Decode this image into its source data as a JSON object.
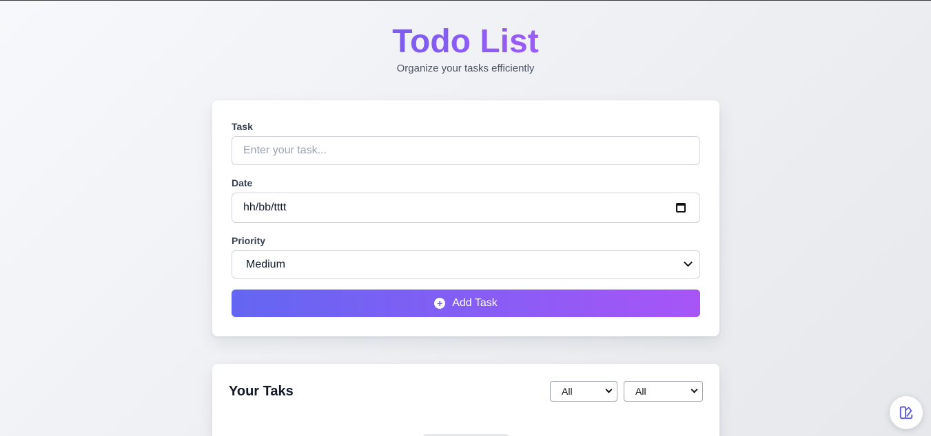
{
  "header": {
    "title": "Todo List",
    "subtitle": "Organize your tasks efficiently"
  },
  "form": {
    "task_label": "Task",
    "task_placeholder": "Enter your task...",
    "date_label": "Date",
    "date_value": "hh/bb/tttt",
    "priority_label": "Priority",
    "priority_value": "Medium",
    "add_button_label": "Add Task"
  },
  "list": {
    "title": "Your Taks",
    "filter_status_value": "All",
    "filter_priority_value": "All"
  },
  "icons": {
    "add": "plus-circle-icon",
    "calendar": "calendar-icon",
    "dropdown": "chevron-down-icon",
    "fab": "theme-palette-icon"
  },
  "colors": {
    "accent": "#8b5cf6",
    "button_start": "#6366f1",
    "button_end": "#a855f7",
    "fab_icon": "#5b5bd6"
  }
}
